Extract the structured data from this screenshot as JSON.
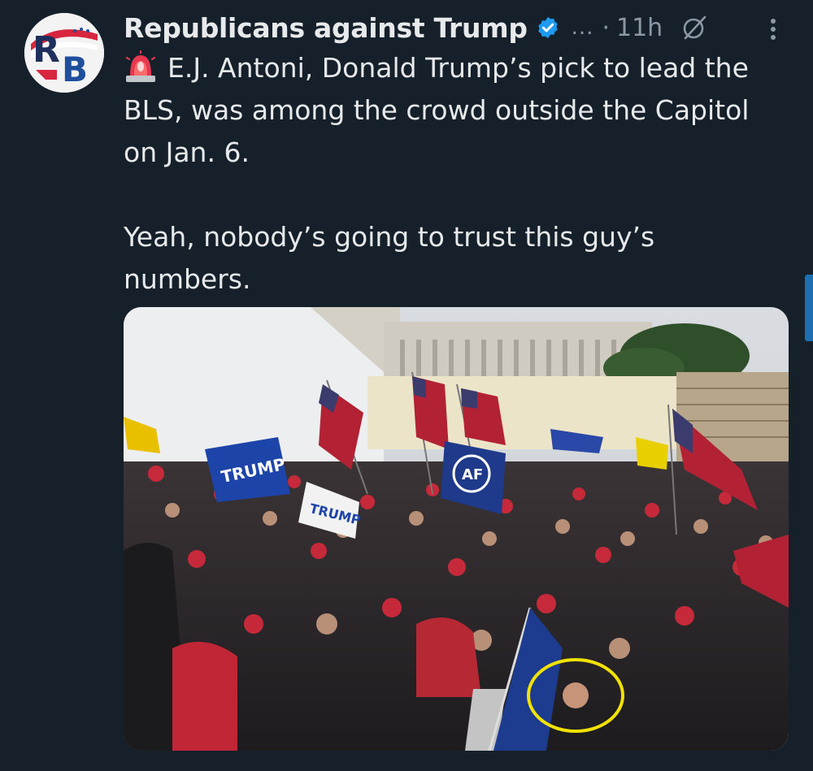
{
  "tweet": {
    "author": {
      "display_name": "Republicans against Trump",
      "verified_icon": "verified-badge-icon",
      "truncated_handle": "...",
      "avatar_text": "RB",
      "avatar_colors": {
        "red": "#d7263d",
        "blue": "#1e4f9c",
        "white": "#ffffff"
      }
    },
    "separator": "·",
    "timestamp": "11h",
    "grok_icon": "grok-icon",
    "more_icon": "more-vertical-icon",
    "text": {
      "emoji": "siren-emoji",
      "line1": "E.J. Antoni, Donald Trump’s pick to lead the BLS, was among the crowd outside the Capitol on Jan. 6.",
      "line2": "Yeah, nobody’s going to trust this guy’s numbers."
    },
    "media": {
      "type": "photo",
      "flag_texts": [
        "TRUMP",
        "TRUMP",
        "AF"
      ],
      "highlight_circle_color": "#f2e200"
    }
  },
  "theme": {
    "background": "#15202b",
    "text_primary": "#e7e9ea",
    "text_secondary": "#8b98a5",
    "accent": "#1d9bf0"
  }
}
